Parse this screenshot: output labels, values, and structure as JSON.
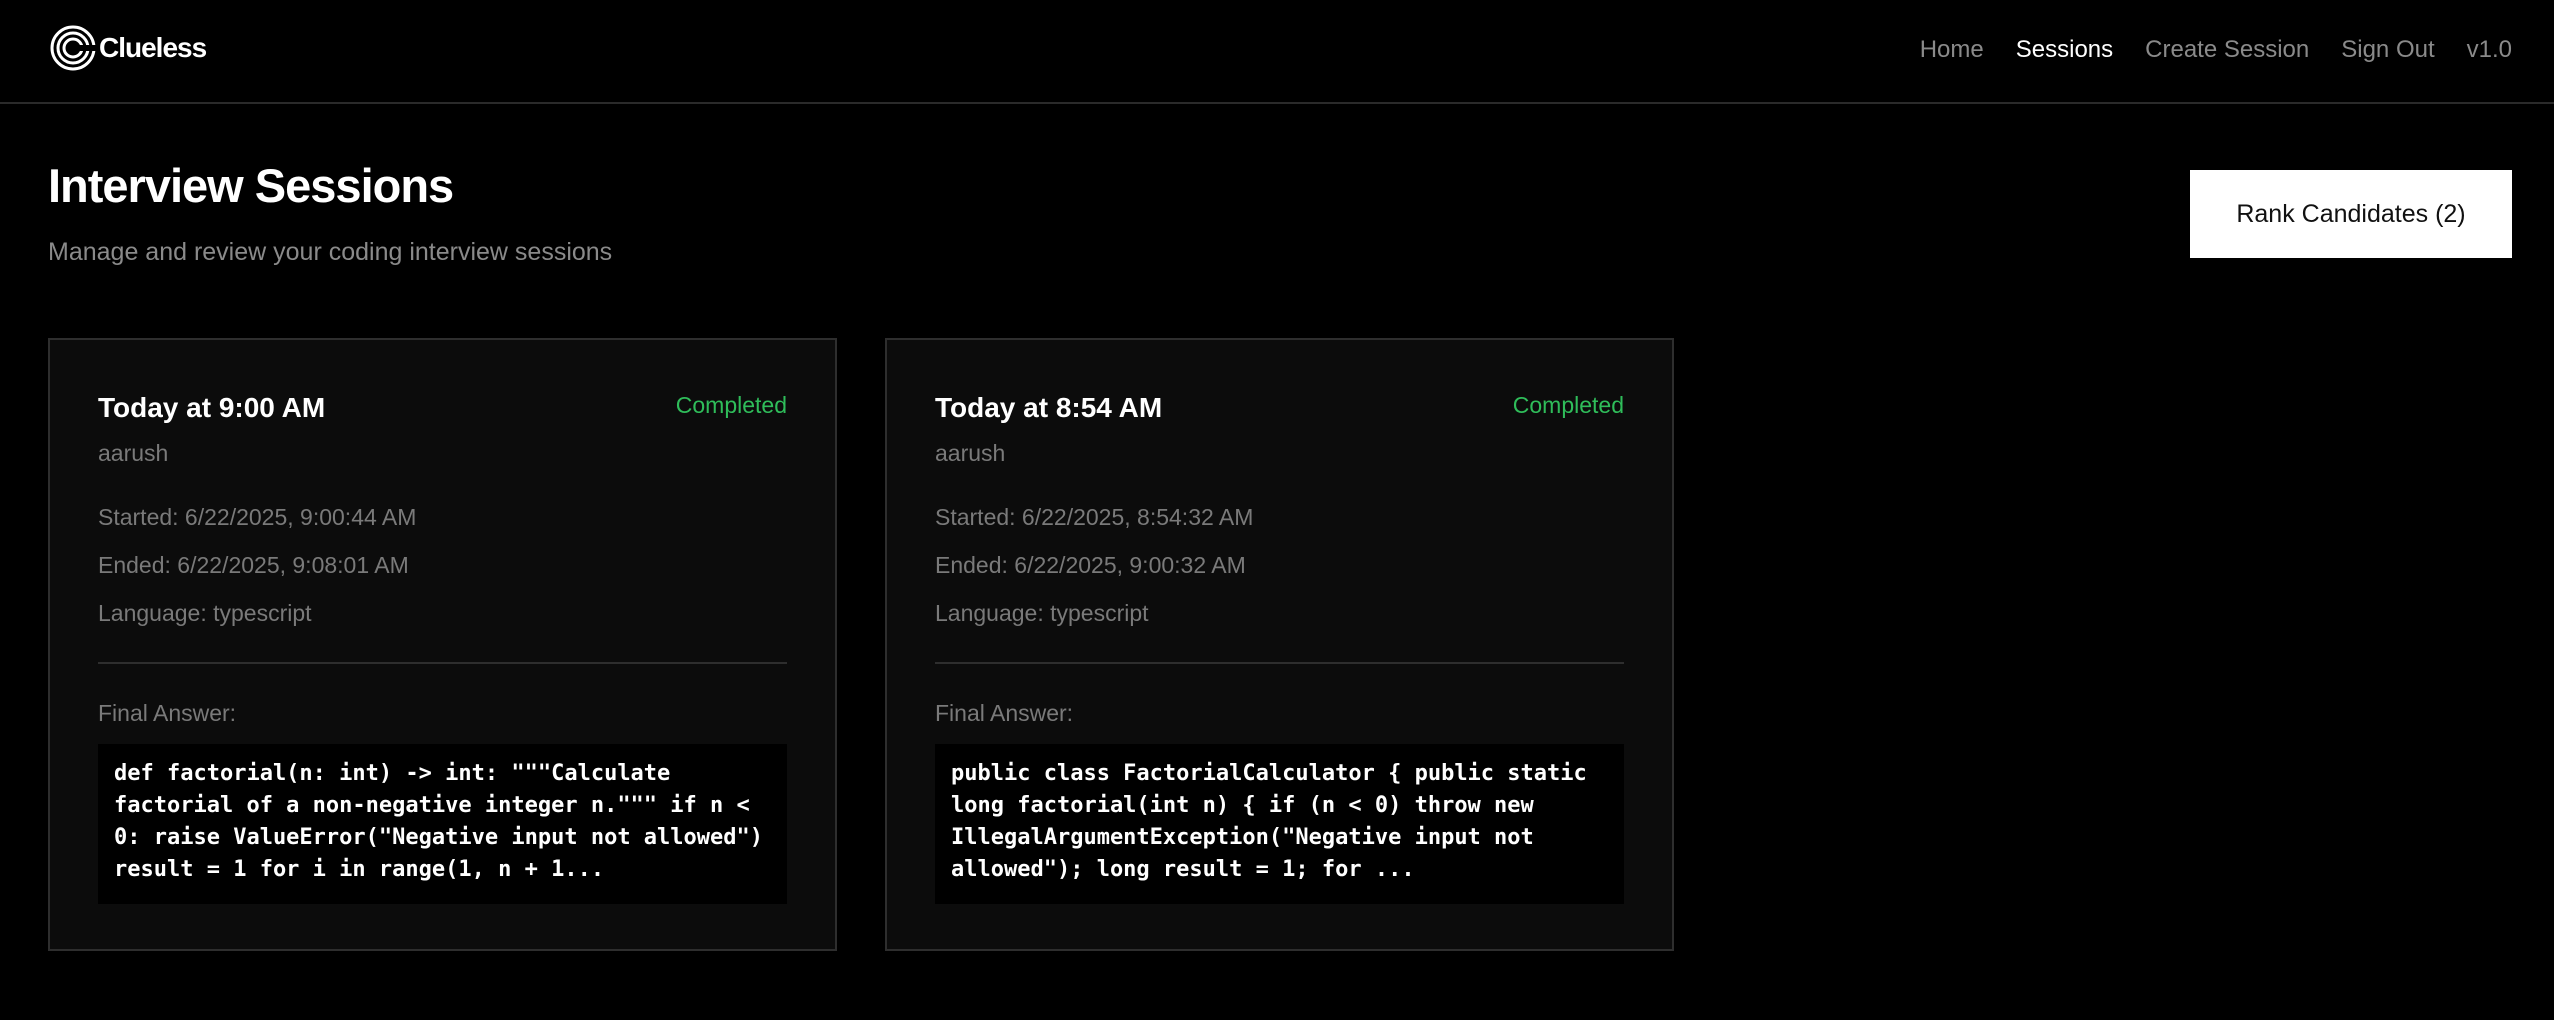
{
  "brand": {
    "name": "Clueless"
  },
  "nav": {
    "items": [
      "Home",
      "Sessions",
      "Create Session",
      "Sign Out"
    ],
    "active": "Sessions",
    "version": "v1.0"
  },
  "header": {
    "title": "Interview Sessions",
    "subtitle": "Manage and review your coding interview sessions",
    "rank_button_label": "Rank Candidates (2)"
  },
  "colors": {
    "background": "#000000",
    "card_background": "#0c0c0c",
    "status_completed": "#2fbd5a",
    "muted_text": "#7a7a7a"
  },
  "sessions": [
    {
      "title": "Today at 9:00 AM",
      "status": "Completed",
      "user": "aarush",
      "started": "Started: 6/22/2025, 9:00:44 AM",
      "ended": "Ended: 6/22/2025, 9:08:01 AM",
      "language": "Language: typescript",
      "final_answer_label": "Final Answer:",
      "final_answer": "def factorial(n: int) -> int: \"\"\"Calculate factorial of a non-negative integer n.\"\"\" if n < 0: raise ValueError(\"Negative input not allowed\") result = 1 for i in range(1, n + 1..."
    },
    {
      "title": "Today at 8:54 AM",
      "status": "Completed",
      "user": "aarush",
      "started": "Started: 6/22/2025, 8:54:32 AM",
      "ended": "Ended: 6/22/2025, 9:00:32 AM",
      "language": "Language: typescript",
      "final_answer_label": "Final Answer:",
      "final_answer": "public class FactorialCalculator { public static long factorial(int n) { if (n < 0) throw new IllegalArgumentException(\"Negative input not allowed\"); long result = 1; for ..."
    }
  ]
}
